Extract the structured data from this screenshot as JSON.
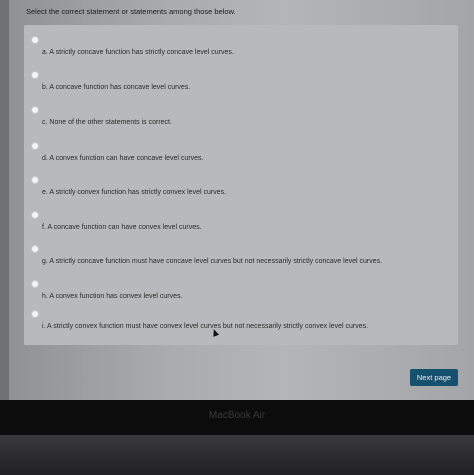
{
  "question": {
    "prompt": "Select the correct statement or statements among those below."
  },
  "options": [
    {
      "label": "a. A strictly concave function has strictly concave level curves."
    },
    {
      "label": "b. A concave function has concave level curves."
    },
    {
      "label": "c. None of the other statements is correct."
    },
    {
      "label": "d. A convex function can have concave level curves."
    },
    {
      "label": "e. A strictly convex function has strictly convex level curves."
    },
    {
      "label": "f. A concave function can have convex level curves."
    },
    {
      "label": "g. A strictly concave function must have concave level curves but not necessarily strictly concave level curves."
    },
    {
      "label": "h. A convex function has convex level curves."
    },
    {
      "label": "i. A strictly convex function must have convex level curves but not necessarily strictly convex level curves."
    }
  ],
  "navigation": {
    "next_label": "Next page"
  },
  "device": {
    "brand": "MacBook Air"
  },
  "colors": {
    "accent": "#15506f"
  },
  "icons": {
    "cursor": "mouse-cursor-icon"
  }
}
